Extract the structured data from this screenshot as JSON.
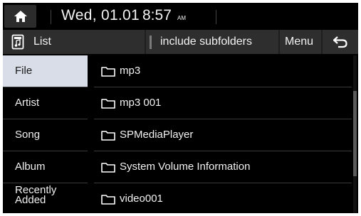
{
  "statusbar": {
    "home_icon": "home-icon",
    "date": "Wed, 01.01",
    "time": "8:57",
    "ampm": "AM"
  },
  "toolbar": {
    "list_icon": "music-file-icon",
    "list_label": "List",
    "subfolder_label": "include subfolders",
    "menu_label": "Menu",
    "back_icon": "back-arrow-icon"
  },
  "categories": [
    {
      "label": "File",
      "active": true
    },
    {
      "label": "Artist",
      "active": false
    },
    {
      "label": "Song",
      "active": false
    },
    {
      "label": "Album",
      "active": false
    },
    {
      "label": "Recently Added",
      "active": false
    }
  ],
  "files": [
    {
      "name": "mp3",
      "icon": "folder-icon"
    },
    {
      "name": "mp3 001",
      "icon": "folder-icon"
    },
    {
      "name": "SPMediaPlayer",
      "icon": "folder-icon"
    },
    {
      "name": "System Volume Information",
      "icon": "folder-icon"
    },
    {
      "name": "video001",
      "icon": "folder-icon"
    }
  ],
  "colors": {
    "background": "#000000",
    "button": "#2e2e2e",
    "active_category": "#d9dde7",
    "text": "#f2f2f2"
  }
}
